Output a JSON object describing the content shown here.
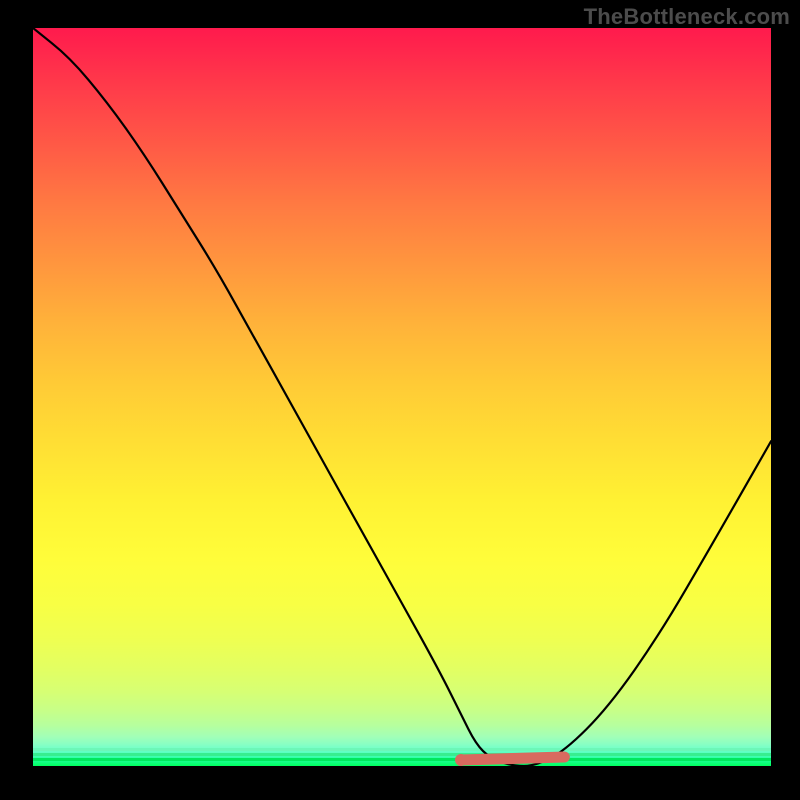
{
  "attribution": "TheBottleneck.com",
  "chart_data": {
    "type": "line",
    "title": "",
    "xlabel": "",
    "ylabel": "",
    "xlim": [
      0,
      100
    ],
    "ylim": [
      0,
      100
    ],
    "grid": false,
    "legend": false,
    "x": [
      0,
      5,
      10,
      15,
      20,
      25,
      30,
      35,
      40,
      45,
      50,
      55,
      58,
      60,
      62,
      65,
      68,
      72,
      78,
      85,
      92,
      100
    ],
    "values": [
      100,
      96,
      90,
      83,
      75,
      67,
      58,
      49,
      40,
      31,
      22,
      13,
      7,
      3,
      1,
      0,
      0,
      2,
      8,
      18,
      30,
      44
    ],
    "marker": {
      "x_start": 58,
      "x_end": 72,
      "y": 0
    },
    "background": {
      "type": "vertical-gradient",
      "top": "#ff1a4d",
      "mid": "#fff133",
      "bottom": "#00ff60"
    }
  }
}
